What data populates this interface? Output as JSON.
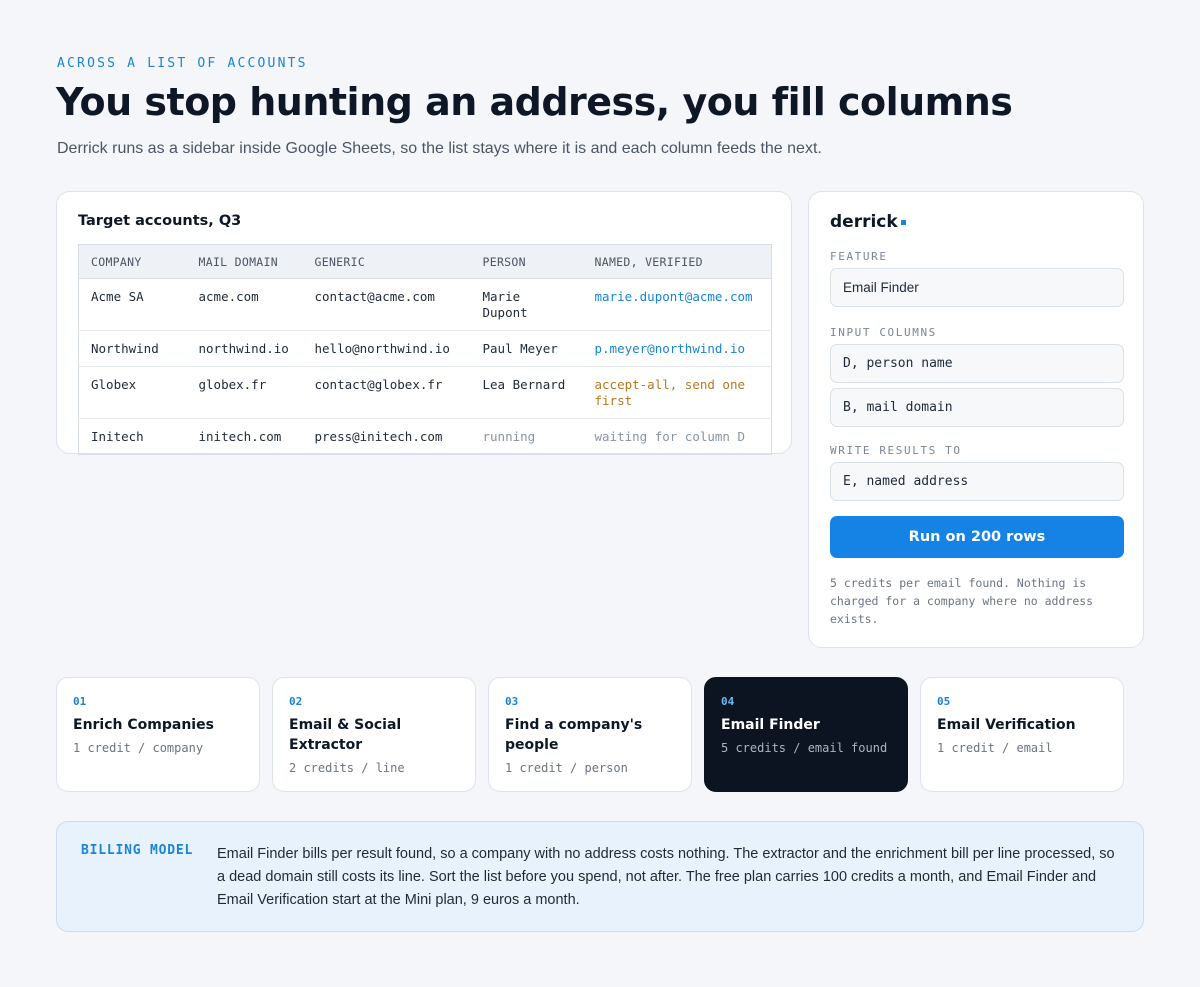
{
  "header": {
    "eyebrow": "ACROSS A LIST OF ACCOUNTS",
    "title": "You stop hunting an address, you fill columns",
    "subtitle": "Derrick runs as a sidebar inside Google Sheets, so the list stays where it is and each column feeds the next."
  },
  "sheet": {
    "title": "Target accounts, Q3",
    "columns": [
      "COMPANY",
      "MAIL DOMAIN",
      "GENERIC",
      "PERSON",
      "NAMED, VERIFIED"
    ],
    "rows": [
      [
        "Acme SA",
        "acme.com",
        "contact@acme.com",
        "Marie Dupont",
        "marie.dupont@acme.com"
      ],
      [
        "Northwind",
        "northwind.io",
        "hello@northwind.io",
        "Paul Meyer",
        "p.meyer@northwind.io"
      ],
      [
        "Globex",
        "globex.fr",
        "contact@globex.fr",
        "Lea Bernard",
        "accept-all, send one first"
      ],
      [
        "Initech",
        "initech.com",
        "press@initech.com",
        "running",
        "waiting for column D"
      ]
    ]
  },
  "sidebar": {
    "brand": "derrick",
    "feature_label": "FEATURE",
    "feature_value": "Email Finder",
    "input_columns_label": "INPUT COLUMNS",
    "input_column_1": "D, person name",
    "input_column_2": "B, mail domain",
    "write_results_label": "WRITE RESULTS TO",
    "write_results_value": "E, named address",
    "run_button": "Run on 200 rows",
    "note": "5 credits per email found. Nothing is charged for a company where no address exists.",
    "accent_color": "#1582e6"
  },
  "features": [
    {
      "num": "01",
      "name": "Enrich Companies",
      "price": "1 credit / company"
    },
    {
      "num": "02",
      "name": "Email & Social Extractor",
      "price": "2 credits / line"
    },
    {
      "num": "03",
      "name": "Find a company's people",
      "price": "1 credit / person"
    },
    {
      "num": "04",
      "name": "Email Finder",
      "price": "5 credits / email found"
    },
    {
      "num": "05",
      "name": "Email Verification",
      "price": "1 credit / email"
    }
  ],
  "billing": {
    "label": "BILLING MODEL",
    "text": "Email Finder bills per result found, so a company with no address costs nothing. The extractor and the enrichment bill per line processed, so a dead domain still costs its line. Sort the list before you spend, not after. The free plan carries 100 credits a month, and Email Finder and Email Verification start at the Mini plan, 9 euros a month."
  }
}
